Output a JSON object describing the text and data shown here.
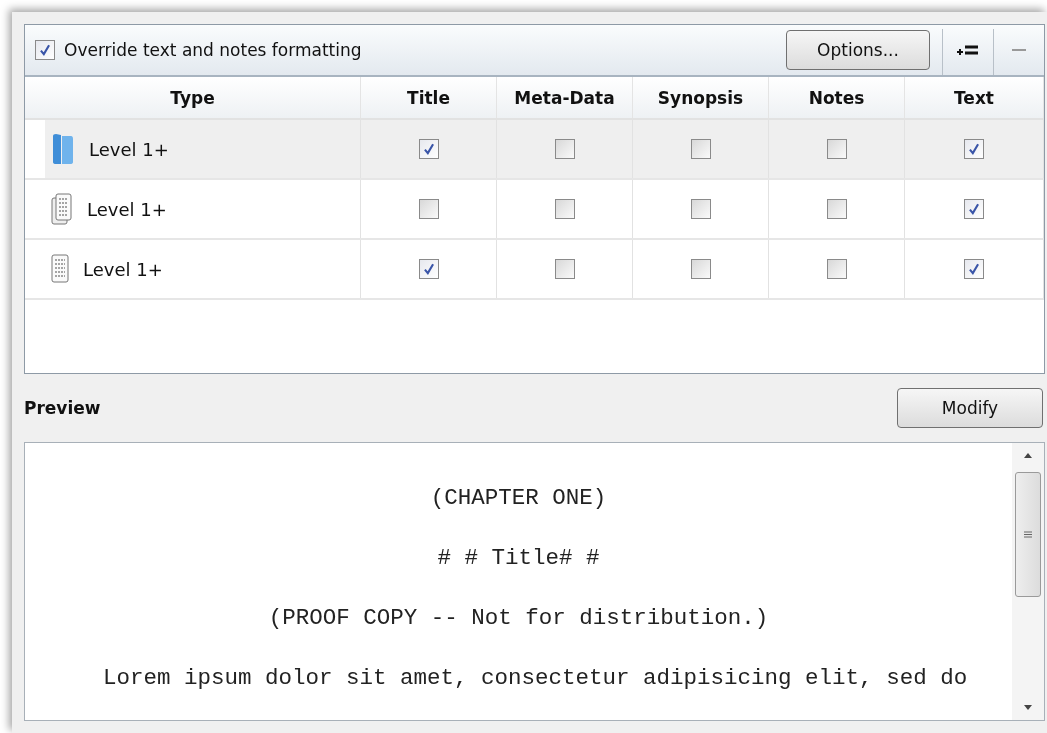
{
  "override": {
    "label": "Override text and notes formatting",
    "checked": true
  },
  "toolbar": {
    "options_button": "Options..."
  },
  "table": {
    "columns": [
      "Type",
      "Title",
      "Meta-Data",
      "Synopsis",
      "Notes",
      "Text"
    ],
    "rows": [
      {
        "kind": "folder",
        "label": "Level 1+",
        "selected": true,
        "checks": [
          true,
          false,
          false,
          false,
          true
        ]
      },
      {
        "kind": "documents",
        "label": "Level 1+",
        "selected": false,
        "checks": [
          false,
          false,
          false,
          false,
          true
        ]
      },
      {
        "kind": "document",
        "label": "Level 1+",
        "selected": false,
        "checks": [
          true,
          false,
          false,
          false,
          true
        ]
      }
    ]
  },
  "preview": {
    "label": "Preview",
    "modify_button": "Modify",
    "lines": [
      {
        "kind": "centered",
        "text": "(CHAPTER ONE)"
      },
      {
        "kind": "centered",
        "text": "# # Title# #"
      },
      {
        "kind": "centered",
        "text": "(PROOF COPY -- Not for distribution.)"
      },
      {
        "kind": "paragraph",
        "text": "Lorem ipsum dolor sit amet, consectetur adipisicing elit, sed do"
      }
    ]
  }
}
